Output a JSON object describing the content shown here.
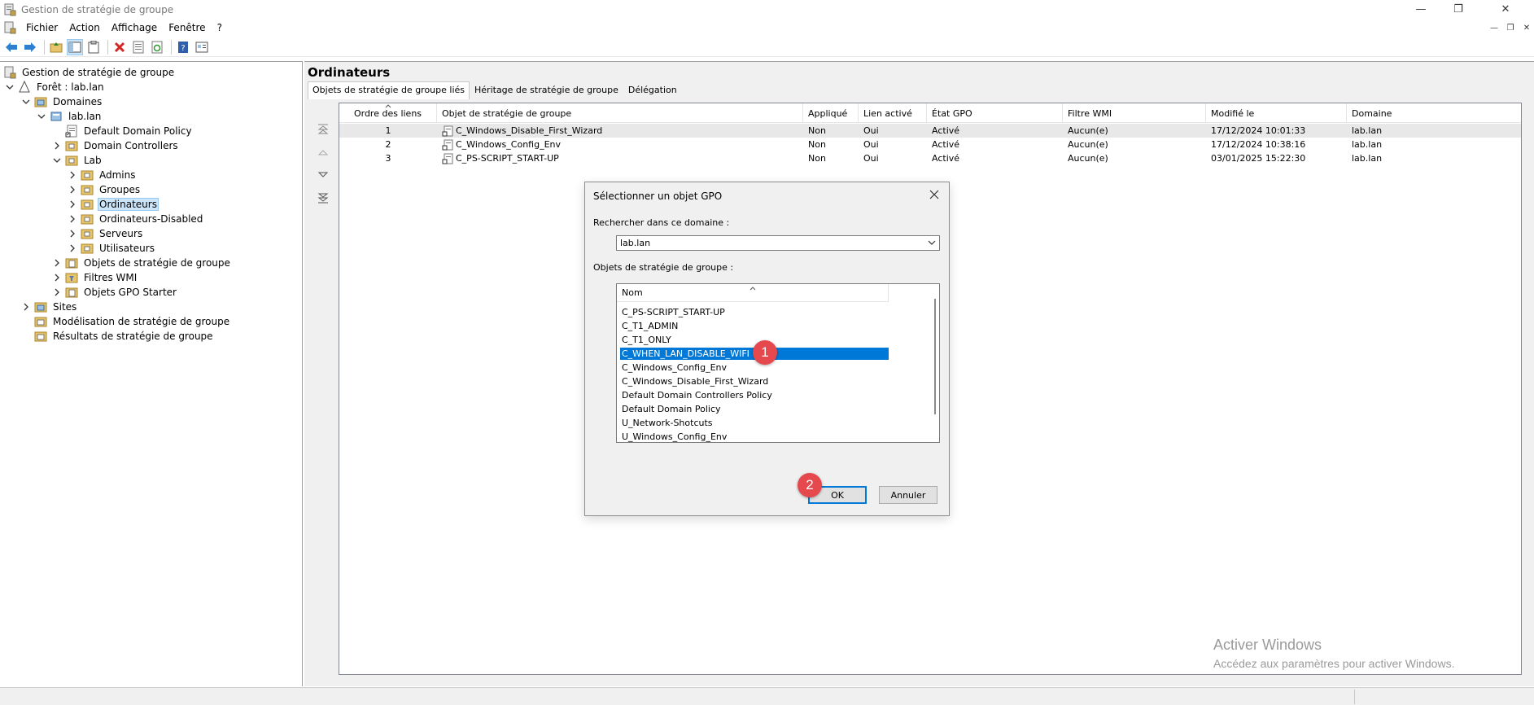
{
  "window": {
    "title": "Gestion de stratégie de groupe",
    "controls": {
      "minimize": "—",
      "maximize": "❐",
      "close": "✕"
    }
  },
  "menubar": {
    "items": [
      "Fichier",
      "Action",
      "Affichage",
      "Fenêtre",
      "?"
    ]
  },
  "tree": {
    "root": "Gestion de stratégie de groupe",
    "forest": "Forêt : lab.lan",
    "domaines": "Domaines",
    "domain": "lab.lan",
    "default_policy": "Default Domain Policy",
    "domain_controllers": "Domain Controllers",
    "lab": "Lab",
    "lab_children": [
      "Admins",
      "Groupes",
      "Ordinateurs",
      "Ordinateurs-Disabled",
      "Serveurs",
      "Utilisateurs"
    ],
    "gpo_objects": "Objets de stratégie de groupe",
    "wmi_filters": "Filtres WMI",
    "starter_gpo": "Objets GPO Starter",
    "sites": "Sites",
    "modeling": "Modélisation de stratégie de groupe",
    "results": "Résultats de stratégie de groupe",
    "selected": "Ordinateurs"
  },
  "right": {
    "title": "Ordinateurs",
    "tabs": [
      "Objets de stratégie de groupe liés",
      "Héritage de stratégie de groupe",
      "Délégation"
    ],
    "columns": [
      "Ordre des liens",
      "Objet de stratégie de groupe",
      "Appliqué",
      "Lien activé",
      "État GPO",
      "Filtre WMI",
      "Modifié le",
      "Domaine"
    ],
    "rows": [
      {
        "order": "1",
        "gpo": "C_Windows_Disable_First_Wizard",
        "enforced": "Non",
        "enabled": "Oui",
        "status": "Activé",
        "wmi": "Aucun(e)",
        "modified": "17/12/2024 10:01:33",
        "domain": "lab.lan"
      },
      {
        "order": "2",
        "gpo": "C_Windows_Config_Env",
        "enforced": "Non",
        "enabled": "Oui",
        "status": "Activé",
        "wmi": "Aucun(e)",
        "modified": "17/12/2024 10:38:16",
        "domain": "lab.lan"
      },
      {
        "order": "3",
        "gpo": "C_PS-SCRIPT_START-UP",
        "enforced": "Non",
        "enabled": "Oui",
        "status": "Activé",
        "wmi": "Aucun(e)",
        "modified": "03/01/2025 15:22:30",
        "domain": "lab.lan"
      }
    ]
  },
  "dialog": {
    "title": "Sélectionner un objet GPO",
    "domain_label": "Rechercher dans ce domaine :",
    "domain_value": "lab.lan",
    "list_label": "Objets de stratégie de groupe :",
    "list_header": "Nom",
    "items": [
      "C_PS-SCRIPT_START-UP",
      "C_T1_ADMIN",
      "C_T1_ONLY",
      "C_WHEN_LAN_DISABLE_WIFI",
      "C_Windows_Config_Env",
      "C_Windows_Disable_First_Wizard",
      "Default Domain Controllers Policy",
      "Default Domain Policy",
      "U_Network-Shotcuts",
      "U_Windows_Config_Env"
    ],
    "selected_item": "C_WHEN_LAN_DISABLE_WIFI",
    "ok_label": "OK",
    "cancel_label": "Annuler"
  },
  "badges": {
    "step1": "1",
    "step2": "2"
  },
  "watermark": {
    "line1": "Activer Windows",
    "line2": "Accédez aux paramètres pour activer Windows."
  },
  "colors": {
    "selection": "#0078d7",
    "tree_selection": "#cce4f7",
    "badge": "#e5484d"
  }
}
